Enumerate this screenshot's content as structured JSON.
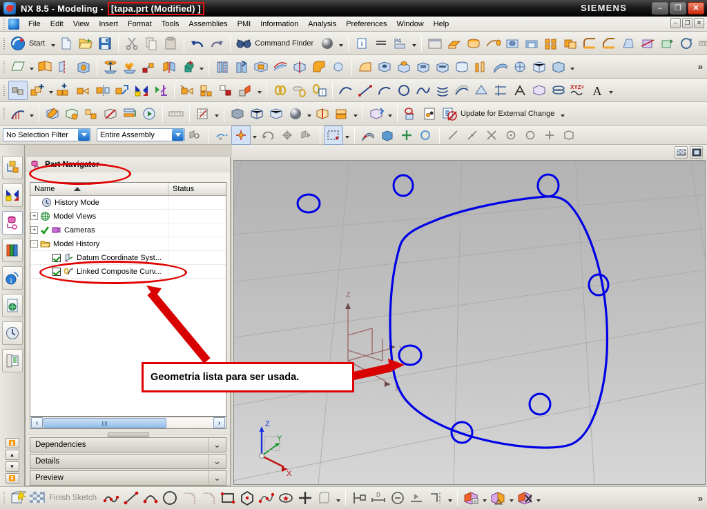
{
  "window": {
    "icon": "nx-app-icon",
    "title_prefix": "NX 8.5 - Modeling -",
    "title_highlight": "[tapa.prt (Modified) ]",
    "brand": "SIEMENS",
    "minimize": "–",
    "restore": "❐",
    "close": "✕"
  },
  "menubar": {
    "items": [
      {
        "label": "File"
      },
      {
        "label": "Edit"
      },
      {
        "label": "View"
      },
      {
        "label": "Insert"
      },
      {
        "label": "Format"
      },
      {
        "label": "Tools"
      },
      {
        "label": "Assemblies"
      },
      {
        "label": "PMI"
      },
      {
        "label": "Information"
      },
      {
        "label": "Analysis"
      },
      {
        "label": "Preferences"
      },
      {
        "label": "Window"
      },
      {
        "label": "Help"
      }
    ],
    "doc_minimize": "–",
    "doc_restore": "❐",
    "doc_close": "✕"
  },
  "standard_toolbar": {
    "start_label": "Start",
    "command_finder_label": "Command Finder",
    "buttons": [
      {
        "name": "new-button",
        "tip": "New"
      },
      {
        "name": "open-button",
        "tip": "Open"
      },
      {
        "name": "save-button",
        "tip": "Save"
      },
      {
        "name": "cut-button",
        "tip": "Cut"
      },
      {
        "name": "copy-button",
        "tip": "Copy"
      },
      {
        "name": "paste-button",
        "tip": "Paste"
      },
      {
        "name": "undo-button",
        "tip": "Undo"
      },
      {
        "name": "redo-button",
        "tip": "Redo"
      }
    ]
  },
  "utility_toolbar": {
    "update_label": "Update for External Change"
  },
  "selection_bar": {
    "filter": {
      "value": "No Selection Filter",
      "placeholder": "No Selection Filter"
    },
    "scope": {
      "value": "Entire Assembly",
      "placeholder": "Entire Assembly"
    }
  },
  "resource_bar": {
    "items": [
      {
        "name": "assembly-navigator-icon",
        "label": "Assembly Navigator"
      },
      {
        "name": "constraint-navigator-icon",
        "label": "Constraint Navigator"
      },
      {
        "name": "part-navigator-icon",
        "label": "Part Navigator",
        "active": true
      },
      {
        "name": "reuse-library-icon",
        "label": "Reuse Library"
      },
      {
        "name": "hd3d-tools-icon",
        "label": "HD3D Tools"
      },
      {
        "name": "web-browser-icon",
        "label": "Web Browser"
      },
      {
        "name": "history-icon",
        "label": "History"
      },
      {
        "name": "roles-icon",
        "label": "Roles"
      }
    ],
    "nav": [
      "⏫",
      "▲",
      "▼",
      "⏬"
    ]
  },
  "part_navigator": {
    "title": "Part Navigator",
    "columns": {
      "name": "Name",
      "status": "Status"
    },
    "rows": [
      {
        "label": "History Mode",
        "indent": 1,
        "expander": "",
        "icon": "clock-icon",
        "check": false,
        "status": ""
      },
      {
        "label": "Model Views",
        "indent": 0,
        "expander": "+",
        "icon": "model-views-icon",
        "check": false,
        "status": ""
      },
      {
        "label": "Cameras",
        "indent": 0,
        "expander": "+",
        "icon": "cameras-icon",
        "check": false,
        "greencheck": true,
        "status": ""
      },
      {
        "label": "Model History",
        "indent": 0,
        "expander": "-",
        "icon": "folder-icon",
        "check": false,
        "status": ""
      },
      {
        "label": "Datum Coordinate Syst...",
        "indent": 2,
        "expander": "",
        "icon": "datum-csys-icon",
        "check": true,
        "status": ""
      },
      {
        "label": "Linked Composite Curv...",
        "indent": 2,
        "expander": "",
        "icon": "linked-curve-icon",
        "check": true,
        "status": ""
      }
    ],
    "scroll_left": "‹",
    "scroll_right": "›",
    "panels": [
      {
        "label": "Dependencies",
        "chevron": "⌄"
      },
      {
        "label": "Details",
        "chevron": "⌄"
      },
      {
        "label": "Preview",
        "chevron": "⌄"
      }
    ]
  },
  "annotations": {
    "callout_text": "Geometria lista para ser usada.",
    "accent_color": "#e00000",
    "ellipse_part_navigator": "part-navigator-highlight",
    "ellipse_linked_curve": "linked-composite-curve-highlight"
  },
  "viewport": {
    "curve_color": "#0000e6",
    "datum_color": "#9c6b6b",
    "axis_labels": {
      "z": "Z",
      "y": "Y",
      "x": "X"
    },
    "wcs_labels": {
      "z": "Z",
      "y": "Y",
      "x": "X"
    },
    "hole_count": 6
  },
  "status_bar": {
    "finish_sketch_label": "Finish Sketch",
    "more_glyph": "»"
  }
}
